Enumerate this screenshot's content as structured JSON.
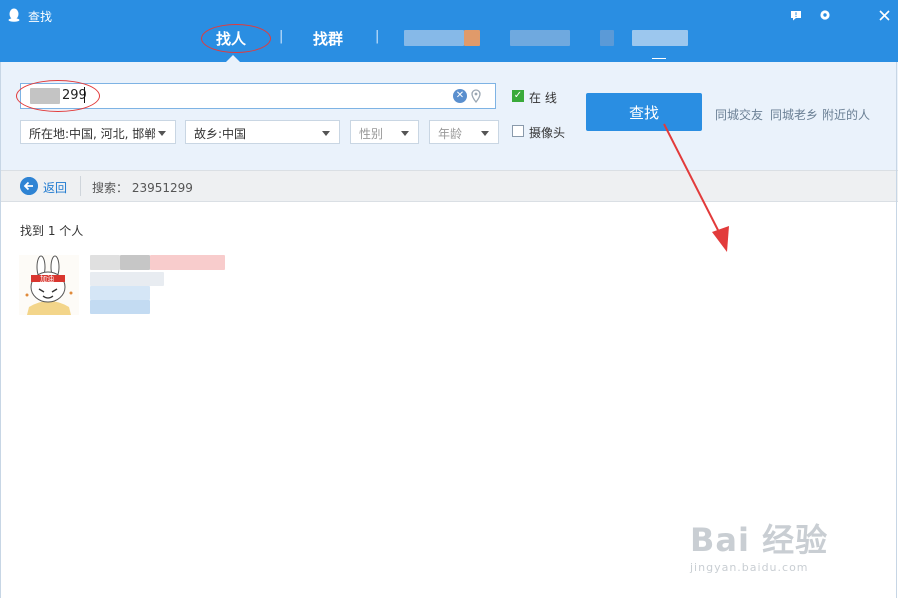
{
  "window": {
    "title": "查找",
    "controls": [
      "feedback-icon",
      "settings-icon",
      "close-icon"
    ]
  },
  "tabs": [
    {
      "label": "找人",
      "active": true
    },
    {
      "label": "找群",
      "active": false
    }
  ],
  "search": {
    "query_value": "299",
    "online_label": "在 线",
    "online_checked": true,
    "camera_label": "摄像头",
    "camera_checked": false,
    "location_select": "所在地:中国, 河北, 邯郸",
    "hometown_select": "故乡:中国",
    "gender_select": "性别",
    "age_select": "年龄",
    "find_button": "查找",
    "quick_links": [
      "同城交友",
      "同城老乡",
      "附近的人"
    ]
  },
  "nav": {
    "back_label": "返回",
    "search_summary": "搜索： 23951299"
  },
  "results": {
    "count_text": "找到 1 个人",
    "avatar_badge": "加油"
  },
  "watermark": {
    "main": "Bai 经验",
    "sub": "jingyan.baidu.com"
  },
  "colors": {
    "titlebar": "#2a8ee2",
    "panel": "#eaf2fb",
    "accent": "#2a8ee2",
    "annotation": "#e23b3b"
  }
}
